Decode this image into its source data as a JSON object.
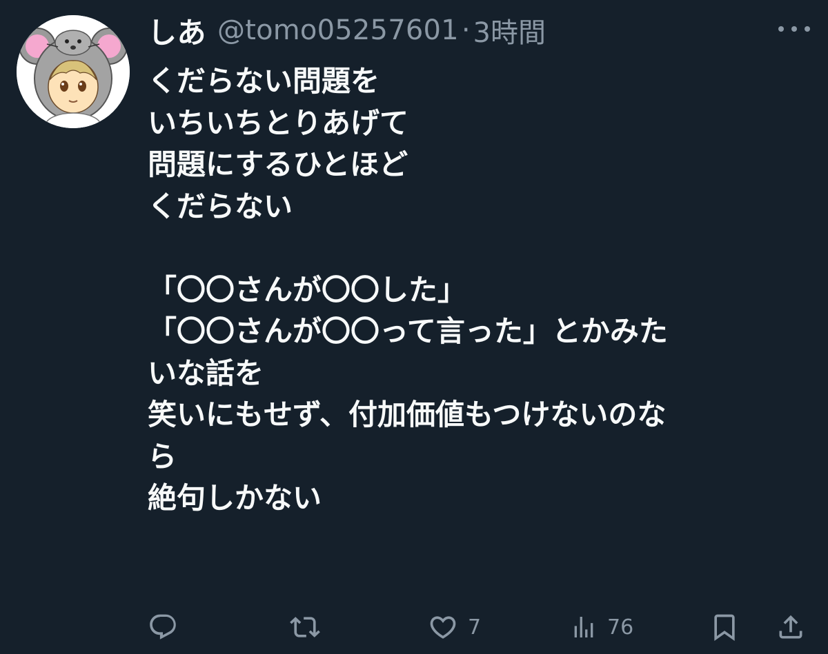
{
  "author": {
    "display_name": "しあ",
    "handle": "@tomo05257601",
    "separator": "·",
    "time": "3時間",
    "avatar_icon": "mouse-hood-character-avatar"
  },
  "tweet_lines": [
    "くだらない問題を",
    "いちいちとりあげて",
    "問題にするひとほど",
    "くだらない",
    "",
    "「〇〇さんが〇〇した」",
    "「〇〇さんが〇〇って言った」とかみた",
    "いな話を",
    "笑いにもせず、付加価値もつけないのな",
    "ら",
    "絶句しかない"
  ],
  "actions": {
    "reply": {
      "icon": "reply-icon",
      "count": ""
    },
    "retweet": {
      "icon": "retweet-icon",
      "count": ""
    },
    "like": {
      "icon": "heart-icon",
      "count": "7"
    },
    "views": {
      "icon": "views-icon",
      "count": "76"
    },
    "bookmark": {
      "icon": "bookmark-icon"
    },
    "share": {
      "icon": "share-icon"
    }
  },
  "colors": {
    "background": "#15202b",
    "text": "#f7f9f9",
    "secondary": "#8b98a5"
  }
}
